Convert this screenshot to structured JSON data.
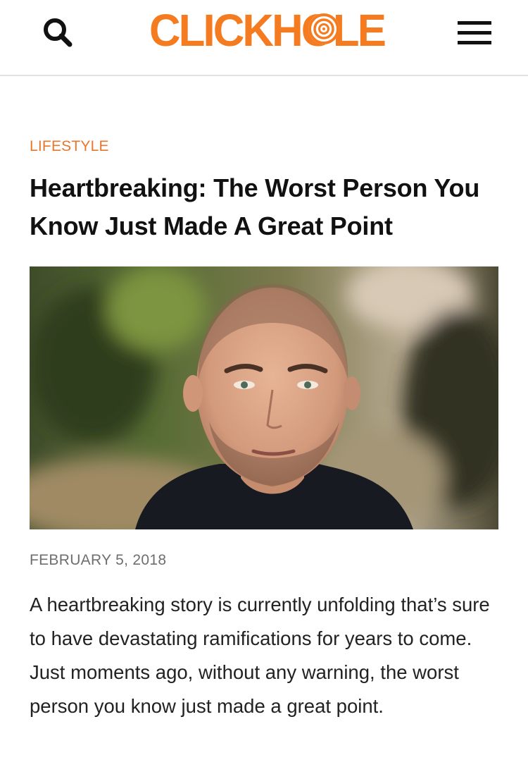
{
  "header": {
    "search_icon": "search-icon",
    "logo_text": "CLICKHOLE",
    "menu_icon": "hamburger-menu-icon",
    "brand_color": "#f47b20"
  },
  "article": {
    "category": "LIFESTYLE",
    "title": "Heartbreaking: The Worst Person You Know Just Made A Great Point",
    "date": "FEBRUARY 5, 2018",
    "body": "A heartbreaking story is currently unfolding that’s sure to have devastating ramifications for years to come. Just moments ago, without any warning, the worst person you know just made a great point.",
    "accent_color": "#e8772e"
  }
}
